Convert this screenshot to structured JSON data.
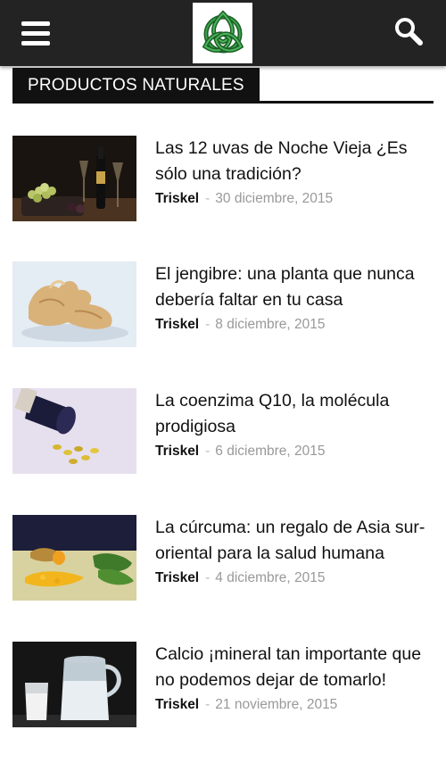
{
  "header": {
    "menu_icon": "hamburger-menu-icon",
    "logo_icon": "triskel-celtic-knot-logo",
    "search_icon": "search-icon",
    "bar_color": "#232323",
    "logo_color": "#1f7a2e"
  },
  "section": {
    "title": "PRODUCTOS NATURALES"
  },
  "articles": [
    {
      "title": "Las 12 uvas de Noche Vieja ¿Es sólo una tradición?",
      "author": "Triskel",
      "separator": "-",
      "date": "30 diciembre, 2015"
    },
    {
      "title": "El jengibre: una planta que nunca debería faltar en tu casa",
      "author": "Triskel",
      "separator": "-",
      "date": "8 diciembre, 2015"
    },
    {
      "title": "La coenzima Q10, la molécula prodigiosa",
      "author": "Triskel",
      "separator": "-",
      "date": "6 diciembre, 2015"
    },
    {
      "title": "La cúrcuma: un regalo de Asia sur-oriental para la salud humana",
      "author": "Triskel",
      "separator": "-",
      "date": "4 diciembre, 2015"
    },
    {
      "title": "Calcio ¡mineral tan importante que no podemos dejar de tomarlo!",
      "author": "Triskel",
      "separator": "-",
      "date": "21 noviembre, 2015"
    }
  ]
}
